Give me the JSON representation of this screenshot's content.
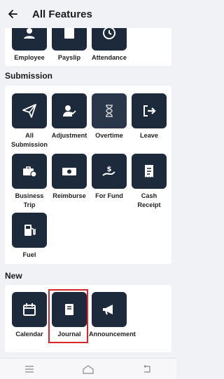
{
  "header": {
    "title": "All Features"
  },
  "top_partial": {
    "items": [
      {
        "label": "Employee"
      },
      {
        "label": "Payslip"
      },
      {
        "label": "Attendance"
      }
    ]
  },
  "submission": {
    "heading": "Submission",
    "items": [
      {
        "label": "All Submission",
        "icon": "send-icon"
      },
      {
        "label": "Adjustment",
        "icon": "user-check-icon"
      },
      {
        "label": "Overtime",
        "icon": "hourglass-icon"
      },
      {
        "label": "Leave",
        "icon": "exit-icon"
      },
      {
        "label": "Business Trip",
        "icon": "briefcase-clock-icon"
      },
      {
        "label": "Reimburse",
        "icon": "banknote-icon"
      },
      {
        "label": "For Fund",
        "icon": "hand-dollar-icon"
      },
      {
        "label": "Cash Receipt",
        "icon": "receipt-icon"
      },
      {
        "label": "Fuel",
        "icon": "fuel-pump-icon"
      }
    ]
  },
  "new": {
    "heading": "New",
    "items": [
      {
        "label": "Calendar",
        "icon": "calendar-icon"
      },
      {
        "label": "Journal",
        "icon": "book-icon"
      },
      {
        "label": "Announcement",
        "icon": "megaphone-icon"
      }
    ]
  },
  "colors": {
    "tile": "#1d2a3b",
    "highlight": "#d7262c",
    "background": "#f1f2f5"
  }
}
